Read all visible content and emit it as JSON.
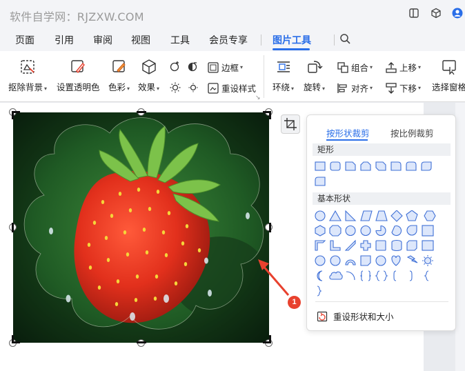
{
  "watermark": "软件自学网：RJZXW.COM",
  "menu": {
    "tabs": [
      {
        "label": "页面"
      },
      {
        "label": "引用"
      },
      {
        "label": "审阅"
      },
      {
        "label": "视图"
      },
      {
        "label": "工具"
      },
      {
        "label": "会员专享"
      },
      {
        "label": "图片工具"
      }
    ],
    "active_tab": "图片工具"
  },
  "ribbon": {
    "remove_bg": "抠除背景",
    "set_transparent": "设置透明色",
    "color": "色彩",
    "effects": "效果",
    "border": "边框",
    "reset_style": "重设样式",
    "wrap": "环绕",
    "rotate": "旋转",
    "group": "组合",
    "align": "对齐",
    "move_up": "上移",
    "move_down": "下移",
    "selection_pane": "选择窗格"
  },
  "panel": {
    "tab_shape": "按形状裁剪",
    "tab_ratio": "按比例裁剪",
    "section_rect": "矩形",
    "section_basic": "基本形状",
    "reset": "重设形状和大小"
  },
  "annotation": {
    "badge": "1"
  },
  "colors": {
    "accent": "#2a6ee8",
    "badge": "#e8412e",
    "arrow": "#e8412e",
    "shape_stroke": "#3e6fd6",
    "shape_fill": "#dde7fb"
  }
}
